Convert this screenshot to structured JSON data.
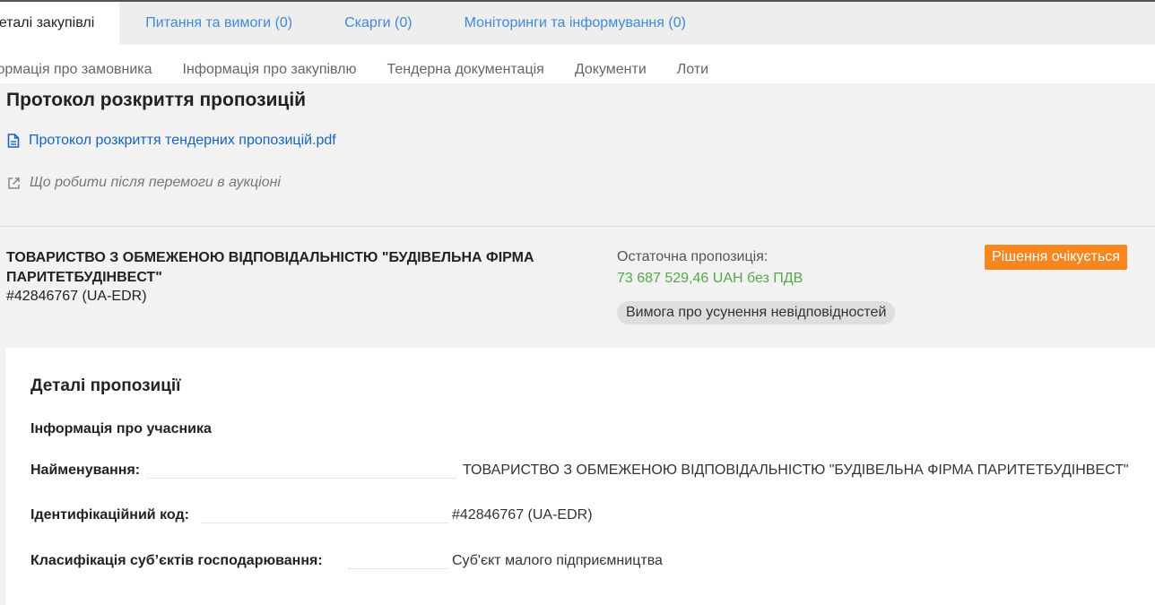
{
  "main_tabs": [
    {
      "label": "Деталі закупівлі",
      "active": true
    },
    {
      "label": "Питання та вимоги (0)",
      "active": false
    },
    {
      "label": "Скарги (0)",
      "active": false
    },
    {
      "label": "Моніторинги та інформування (0)",
      "active": false
    }
  ],
  "sub_tabs": [
    {
      "label": "Інформація про замовника"
    },
    {
      "label": "Інформація про закупівлю"
    },
    {
      "label": "Тендерна документація"
    },
    {
      "label": "Документи"
    },
    {
      "label": "Лоти"
    }
  ],
  "protocol": {
    "title": "Протокол розкриття пропозицій",
    "file_link": "Протокол розкриття тендерних пропозицій.pdf",
    "help_link": "Що робити після перемоги в аукціоні"
  },
  "bid": {
    "name": "ТОВАРИСТВО З ОБМЕЖЕНОЮ ВІДПОВІДАЛЬНІСТЮ \"БУДІВЕЛЬНА ФІРМА ПАРИТЕТБУДІНВЕСТ\"",
    "code": "#42846767 (UA-EDR)",
    "offer_label": "Остаточна пропозиція:",
    "offer_amount": "73 687 529,46 UAH без ПДВ",
    "status": "Рішення очікується",
    "requirement": "Вимога про усунення невідповідностей"
  },
  "details": {
    "title": "Деталі пропозиції",
    "participant_title": "Інформація про учасника",
    "rows": [
      {
        "label": "Найменування:",
        "value": "ТОВАРИСТВО З ОБМЕЖЕНОЮ ВІДПОВІДАЛЬНІСТЮ \"БУДІВЕЛЬНА ФІРМА ПАРИТЕТБУДІНВЕСТ\""
      },
      {
        "label": "Ідентифікаційний код:",
        "value": "#42846767 (UA-EDR)"
      },
      {
        "label": "Класифікація суб’єктів господарювання:",
        "value": "Суб'єкт малого підприємництва"
      }
    ]
  },
  "colors": {
    "link": "#1565c0",
    "tab_link": "#3d8bd9",
    "status_badge": "#f7861f",
    "offer_amount": "#55a84a"
  },
  "icons": {
    "file": "file-icon",
    "external_link": "external-link-icon"
  }
}
